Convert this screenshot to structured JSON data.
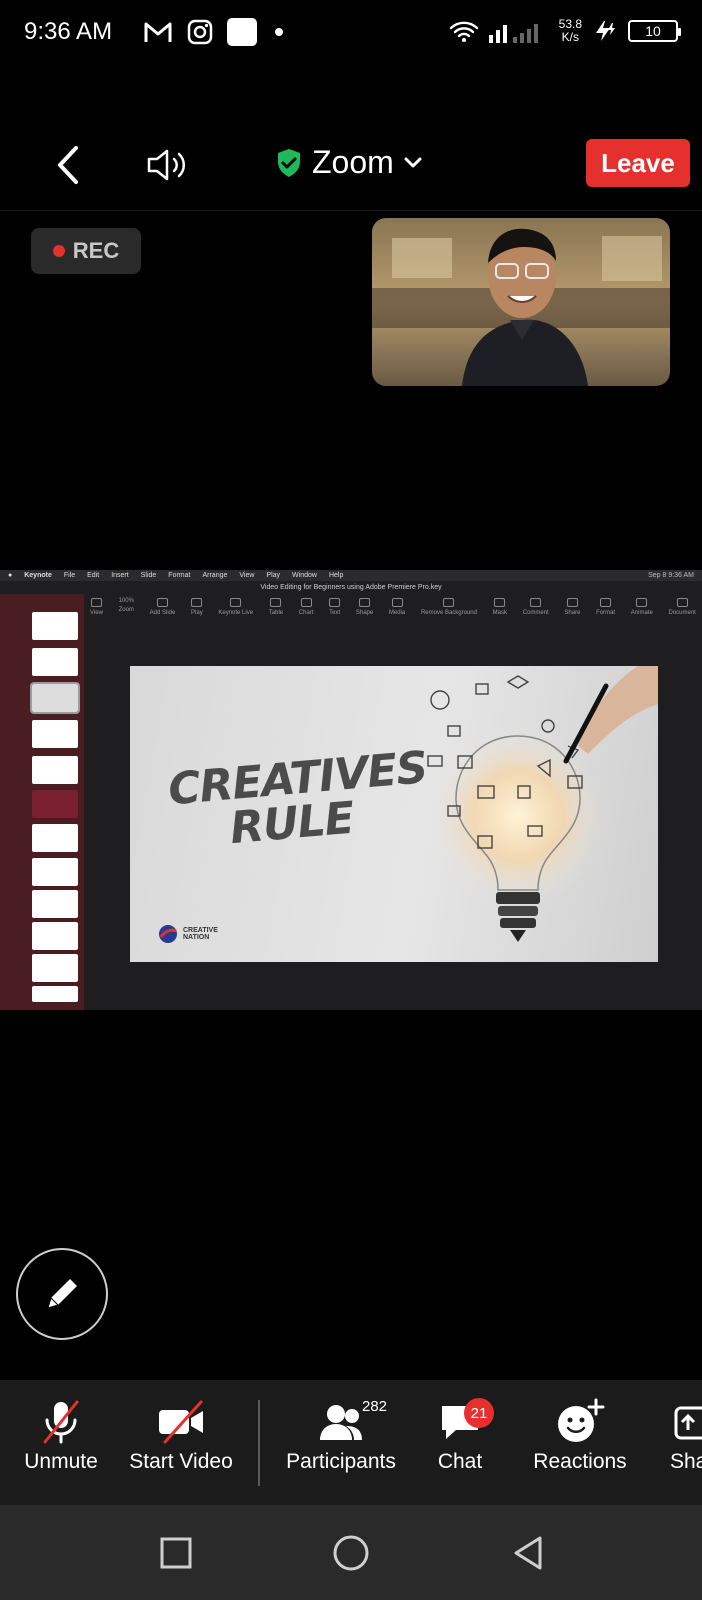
{
  "status_bar": {
    "time": "9:36 AM",
    "net_speed_value": "53.8",
    "net_speed_unit": "K/s",
    "battery": "10"
  },
  "meeting": {
    "title": "Zoom",
    "leave_label": "Leave",
    "rec_label": "REC"
  },
  "shared_screen": {
    "app_menu": [
      "Keynote",
      "File",
      "Edit",
      "Insert",
      "Slide",
      "Format",
      "Arrange",
      "View",
      "Play",
      "Window",
      "Help"
    ],
    "clock": "Sep 8  9:36 AM",
    "document_title": "Video Editing for Beginners using Adobe Premiere Pro.key",
    "zoom_level": "100%",
    "toolbar": [
      "View",
      "Zoom",
      "Add Slide",
      "Play",
      "Keynote Live",
      "Table",
      "Chart",
      "Text",
      "Shape",
      "Media",
      "Remove Background",
      "Mask",
      "Comment",
      "Share",
      "Format",
      "Animate",
      "Document"
    ],
    "slide_title_line1": "CREATIVES",
    "slide_title_line2": "RULE",
    "slide_logo_line1": "CREATIVE",
    "slide_logo_line2": "NATION"
  },
  "bottom_toolbar": {
    "unmute": "Unmute",
    "start_video": "Start Video",
    "participants": "Participants",
    "participants_count": "282",
    "chat": "Chat",
    "chat_badge": "21",
    "reactions": "Reactions",
    "share": "Sha"
  },
  "colors": {
    "leave_red": "#e5302d",
    "shield_green": "#1fb85a",
    "toolbar_bg": "#1b1b1b"
  }
}
